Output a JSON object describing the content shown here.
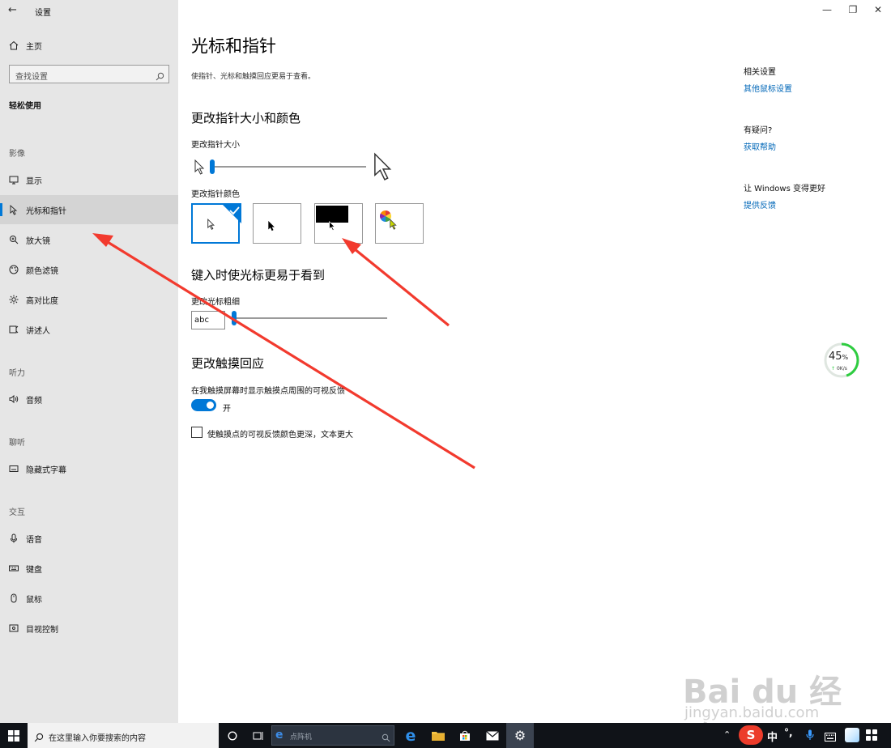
{
  "window": {
    "app_title": "设置",
    "minimize": "—",
    "maximize": "❐",
    "close": "✕"
  },
  "sidebar": {
    "home": "主页",
    "search_placeholder": "查找设置",
    "category": "轻松使用",
    "sections": {
      "vision": "影像",
      "hearing": "听力",
      "audition": "聊听",
      "interaction": "交互"
    },
    "items": [
      {
        "label": "显示",
        "icon": "monitor-icon"
      },
      {
        "label": "光标和指针",
        "icon": "pointer-icon",
        "active": true
      },
      {
        "label": "放大镜",
        "icon": "magnifier-icon"
      },
      {
        "label": "颜色滤镜",
        "icon": "palette-icon"
      },
      {
        "label": "高对比度",
        "icon": "sun-icon"
      },
      {
        "label": "讲述人",
        "icon": "narrator-icon"
      },
      {
        "label": "音频",
        "icon": "speaker-icon"
      },
      {
        "label": "隐藏式字幕",
        "icon": "caption-icon"
      },
      {
        "label": "语音",
        "icon": "microphone-icon"
      },
      {
        "label": "键盘",
        "icon": "keyboard-icon"
      },
      {
        "label": "鼠标",
        "icon": "mouse-icon"
      },
      {
        "label": "目视控制",
        "icon": "eye-control-icon"
      }
    ]
  },
  "main": {
    "title": "光标和指针",
    "description": "使指针、光标和触摸回应更易于查看。",
    "pointer_section": {
      "heading": "更改指针大小和颜色",
      "size_label": "更改指针大小",
      "size_value_fraction": 0.0,
      "color_label": "更改指针颜色",
      "color_options": [
        {
          "name": "white",
          "selected": true
        },
        {
          "name": "black",
          "selected": false
        },
        {
          "name": "inverted",
          "selected": false
        },
        {
          "name": "custom",
          "selected": false
        }
      ]
    },
    "cursor_section": {
      "heading": "键入时使光标更易于看到",
      "thickness_label": "更改光标粗细",
      "preview_text": "abc",
      "thickness_value_fraction": 0.0
    },
    "touch_section": {
      "heading": "更改触摸回应",
      "feedback_label": "在我触摸屏幕时显示触摸点周围的可视反馈",
      "toggle_state": "开",
      "toggle_on": true,
      "checkbox_label": "使触摸点的可视反馈颜色更深，文本更大",
      "checkbox_checked": false
    }
  },
  "related": {
    "heading": "相关设置",
    "mouse_link": "其他鼠标设置",
    "question_heading": "有疑问?",
    "help_link": "获取帮助",
    "better_heading": "让 Windows 变得更好",
    "feedback_link": "提供反馈"
  },
  "speed_widget": {
    "percent": "45",
    "percent_unit": "%",
    "rate": "0K/s",
    "ring_fraction": 0.45,
    "color": "#2ecc40"
  },
  "taskbar": {
    "search_text": "在这里输入你要搜索的内容",
    "ie_search_text": "点阵机",
    "ime_text": "中",
    "ime_punct": "°,",
    "icons": [
      "windows-start-icon",
      "search-icon",
      "cortana-icon",
      "task-view-icon",
      "edge-icon",
      "file-explorer-icon",
      "store-icon",
      "mail-icon",
      "settings-icon"
    ]
  },
  "watermark": {
    "brand": "Bai du 经验",
    "url": "jingyan.baidu.com"
  },
  "colors": {
    "accent": "#0078d7",
    "link": "#0067b8",
    "sidebar_bg": "#e6e6e6",
    "annotation": "#f23a2e"
  }
}
